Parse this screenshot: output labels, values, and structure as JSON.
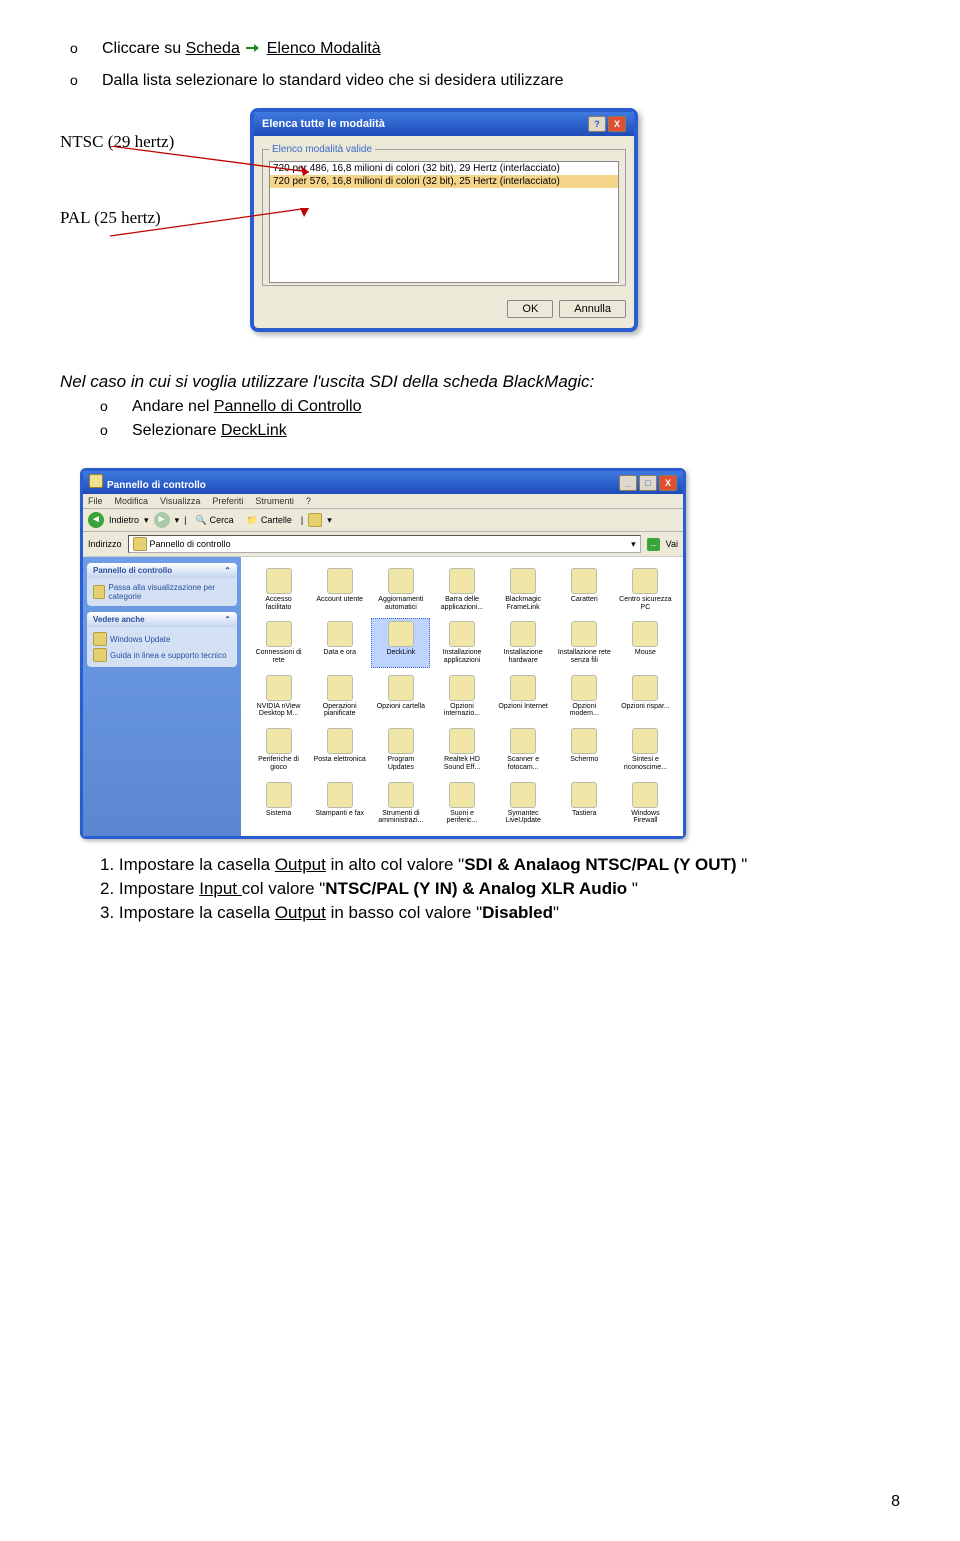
{
  "b1": {
    "o": "o",
    "pre": "Cliccare su  ",
    "a": "Scheda",
    "b": "Elenco Modalità"
  },
  "b2": {
    "o": "o",
    "txt": "Dalla lista  selezionare lo standard video  che si desidera utilizzare"
  },
  "ntsc": "NTSC (29 hertz)",
  "pal": "PAL (25 hertz)",
  "dlg": {
    "title": "Elenca tutte le modalità",
    "legend": "Elenco modalità valide",
    "row1": "720 per 486, 16,8 milioni di colori (32 bit), 29 Hertz (interlacciato)",
    "row2": "720 per 576, 16,8 milioni di colori (32 bit), 25 Hertz (interlacciato)",
    "ok": "OK",
    "cancel": "Annulla",
    "help": "?",
    "close": "X"
  },
  "p2": {
    "l1": "Nel caso in cui si voglia utilizzare l'uscita SDI della scheda BlackMagic:",
    "o1o": "o",
    "o1a": "Andare nel ",
    "o1b": "Pannello di Controllo",
    "o2o": "o",
    "o2a": "Selezionare ",
    "o2b": "DeckLink"
  },
  "cp": {
    "title": "Pannello di controllo",
    "menu": [
      "File",
      "Modifica",
      "Visualizza",
      "Preferiti",
      "Strumenti",
      "?"
    ],
    "tb": {
      "back": "Indietro",
      "search": "Cerca",
      "folders": "Cartelle"
    },
    "addr": {
      "label": "Indirizzo",
      "val": "Pannello di controllo",
      "go": "Vai"
    },
    "side1": {
      "title": "Pannello di controllo",
      "item": "Passa alla visualizzazione per categorie"
    },
    "side2": {
      "title": "Vedere anche",
      "i1": "Windows Update",
      "i2": "Guida in linea e supporto tecnico"
    },
    "items": [
      "Accesso facilitato",
      "Account utente",
      "Aggiornamenti automatici",
      "Barra delle applicazioni...",
      "Blackmagic FrameLink",
      "Caratteri",
      "Centro sicurezza PC",
      "Connessioni di rete",
      "Data e ora",
      "DeckLink",
      "Installazione applicazioni",
      "Installazione hardware",
      "Installazione rete senza fili",
      "Mouse",
      "NVIDIA nView Desktop M...",
      "Operazioni pianificate",
      "Opzioni cartella",
      "Opzioni internazio...",
      "Opzioni Internet",
      "Opzioni modem...",
      "Opzioni rispar...",
      "Periferiche di gioco",
      "Posta elettronica",
      "Program Updates",
      "Realtek HD Sound Eff...",
      "Scanner e fotocam...",
      "Schermo",
      "Sintesi e riconoscime...",
      "Sistema",
      "Stampanti e fax",
      "Strumenti di amministrazi...",
      "Suoni e periferic...",
      "Symantec LiveUpdate",
      "Tastiera",
      "Windows Firewall"
    ],
    "selected_index": 9
  },
  "num": {
    "i1a": "1.  Impostare la casella ",
    "i1u": "Output",
    "i1b": "  in alto col valore \"",
    "i1s": "SDI & Analaog NTSC/PAL (Y OUT)",
    "i1c": " \"",
    "i2a": "2.  Impostare ",
    "i2u": "Input ",
    "i2b": " col valore \"",
    "i2s": "NTSC/PAL (Y IN) & Analog XLR Audio",
    "i2c": " \"",
    "i3a": "3.  Impostare la casella ",
    "i3u": "Output",
    "i3b": "  in basso col valore \"",
    "i3s": "Disabled",
    "i3c": "\""
  },
  "pagenum": "8"
}
